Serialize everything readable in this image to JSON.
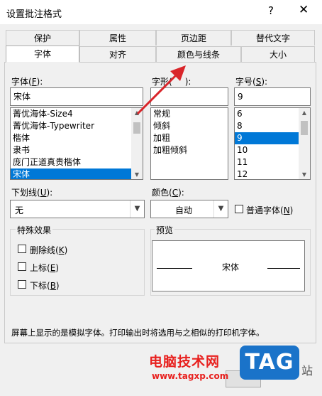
{
  "window": {
    "title": "设置批注格式",
    "help_symbol": "?",
    "close_symbol": "✕"
  },
  "tabs_row1": [
    {
      "label": "保护"
    },
    {
      "label": "属性"
    },
    {
      "label": "页边距"
    },
    {
      "label": "替代文字"
    }
  ],
  "tabs_row2": [
    {
      "label": "字体",
      "active": true
    },
    {
      "label": "对齐"
    },
    {
      "label": "颜色与线条"
    },
    {
      "label": "大小"
    }
  ],
  "font": {
    "label": "字体(",
    "label_key": "F",
    "label_end": "):",
    "value": "宋体",
    "items": [
      "菁优海体-Size4",
      "菁优海体-Typewriter",
      "楷体",
      "隶书",
      "庞门正道真贵楷体",
      "宋体"
    ],
    "selected": "宋体"
  },
  "style": {
    "label": "字形(",
    "label_end": "):",
    "items": [
      "常规",
      "倾斜",
      "加粗",
      "加粗倾斜"
    ]
  },
  "size": {
    "label": "字号(",
    "label_key": "S",
    "label_end": "):",
    "value": "9",
    "items": [
      "6",
      "8",
      "9",
      "10",
      "11",
      "12"
    ],
    "selected": "9"
  },
  "underline": {
    "label": "下划线(",
    "label_key": "U",
    "label_end": "):",
    "value": "无"
  },
  "color": {
    "label": "颜色(",
    "label_key": "C",
    "label_end": "):",
    "value": "自动"
  },
  "normal_font": {
    "label": "普通字体(",
    "label_key": "N",
    "label_end": ")"
  },
  "effects": {
    "title": "特殊效果",
    "strike": {
      "label": "删除线(",
      "key": "K",
      "end": ")"
    },
    "superscript": {
      "label": "上标(",
      "key": "E",
      "end": ")"
    },
    "subscript": {
      "label": "下标(",
      "key": "B",
      "end": ")"
    }
  },
  "preview": {
    "title": "预览",
    "text": "宋体"
  },
  "note": "屏幕上显示的是模拟字体。打印输出时将选用与之相似的打印机字体。",
  "watermark": {
    "site_name": "电脑技术网",
    "url": "www.tagxp.com",
    "logo": "TAG",
    "suffix": "站"
  },
  "colors": {
    "arrow": "#d9252a",
    "selection": "#0078d7",
    "watermark_red": "#e8201e",
    "logo_blue": "#1a73c9"
  }
}
